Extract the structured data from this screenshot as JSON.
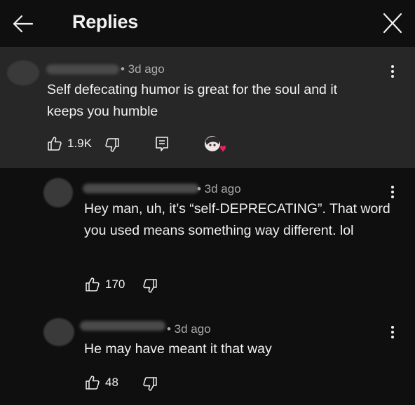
{
  "header": {
    "title": "Replies",
    "back_icon": "arrow-left-icon",
    "close_icon": "close-icon"
  },
  "comments": [
    {
      "time": "• 3d ago",
      "text": "Self defecating humor is great for the soul and it keeps you humble",
      "likes": "1.9K",
      "has_reply_icon": true,
      "creator_heart": true
    },
    {
      "time": "• 3d ago",
      "text": "Hey man, uh, it’s “self-DEPRECATING”. That word you used means something way different. lol",
      "likes": "170"
    },
    {
      "time": "• 3d ago",
      "text": "He may have meant it that way",
      "likes": "48"
    }
  ],
  "colors": {
    "background": "#0f0f0f",
    "highlighted_comment": "#272727",
    "secondary_text": "#aaaaaa",
    "heart": "#e0245e"
  }
}
